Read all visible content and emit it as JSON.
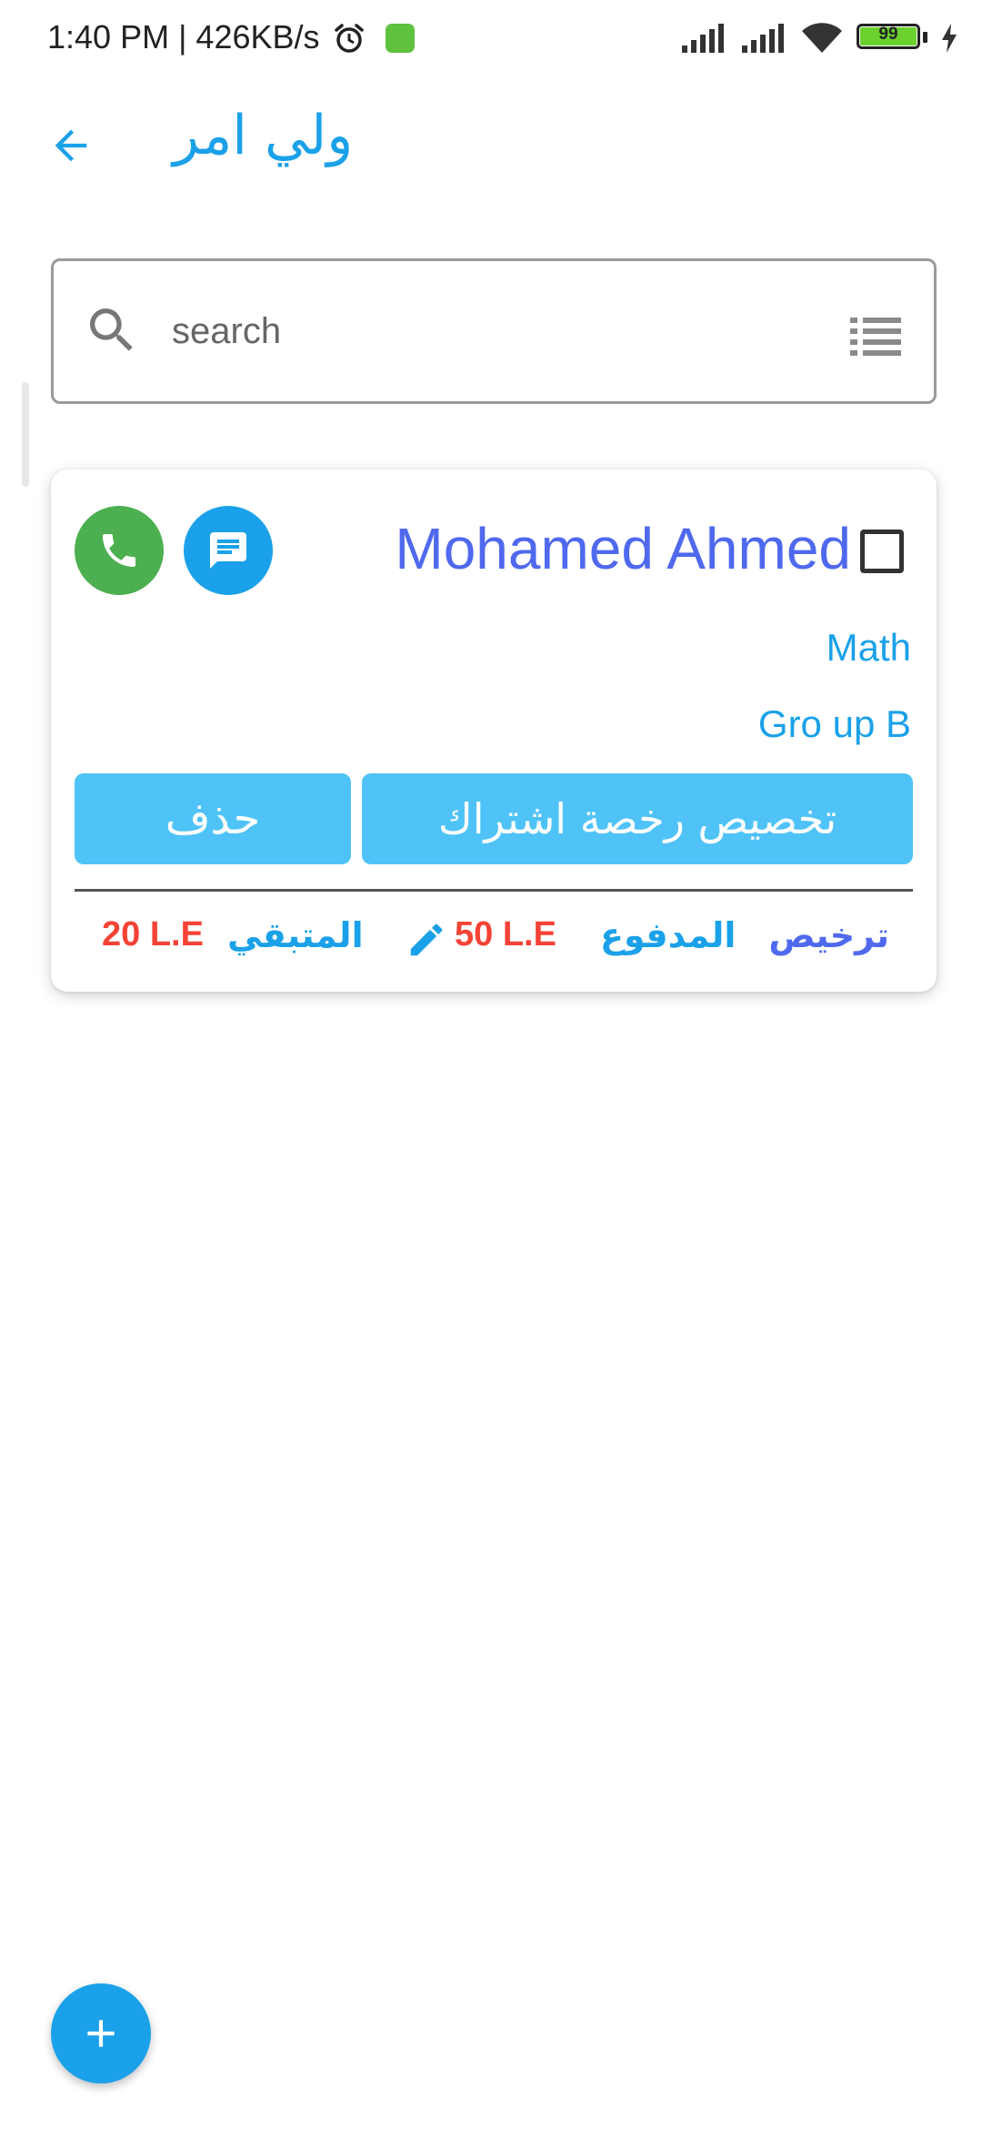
{
  "status_bar": {
    "time_speed": "1:40 PM | 426KB/s",
    "battery_level": "99"
  },
  "app_bar": {
    "title": "ولي امر",
    "back_icon": "arrow-left-icon"
  },
  "search": {
    "placeholder": "search",
    "search_icon": "search-icon",
    "filter_icon": "filter-list-icon"
  },
  "card": {
    "name": "Mohamed Ahmed",
    "subject": "Math",
    "group": "Gro up B",
    "delete_label": "حذف",
    "subscribe_label": "تخصيص رخصة اشتراك",
    "license_label": "ترخيص",
    "paid_label": "المدفوع",
    "paid_value": "50 L.E",
    "remaining_label": "المتبقي",
    "remaining_value": "20 L.E",
    "call_icon": "phone-icon",
    "message_icon": "message-icon",
    "edit_icon": "pencil-icon"
  },
  "fab": {
    "icon": "plus-icon"
  },
  "colors": {
    "primary": "#1ba1e9",
    "name": "#4f69ee",
    "button": "#4fc3f7",
    "call": "#4caf50",
    "value": "#f44336"
  }
}
